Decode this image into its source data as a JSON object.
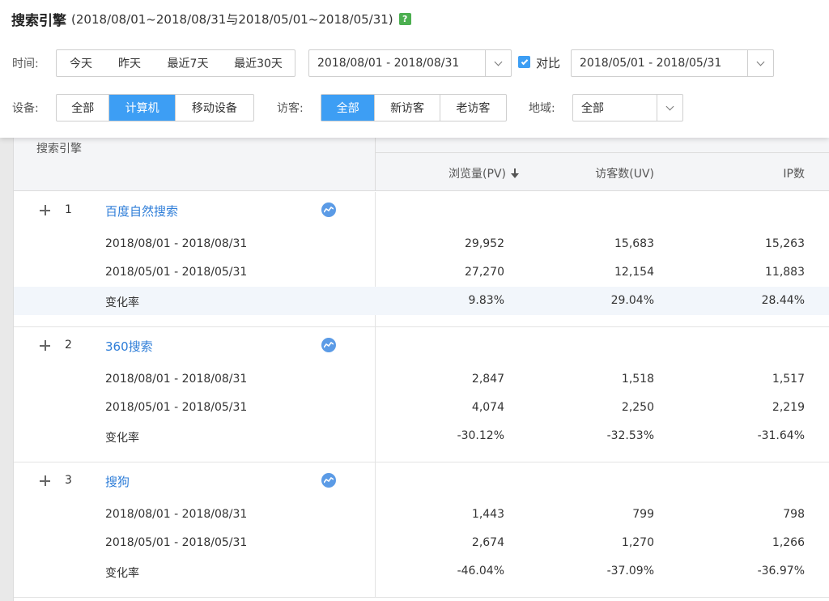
{
  "header": {
    "title": "搜索引擎",
    "title_range": "(2018/08/01~2018/08/31与2018/05/01~2018/05/31)",
    "help_label": "?"
  },
  "filters": {
    "time_label": "时间:",
    "time_buttons": [
      "今天",
      "昨天",
      "最近7天",
      "最近30天"
    ],
    "date_range": "2018/08/01 - 2018/08/31",
    "compare_label": "对比",
    "compare_checked": true,
    "compare_range": "2018/05/01 - 2018/05/31",
    "device_label": "设备:",
    "device_buttons": [
      "全部",
      "计算机",
      "移动设备"
    ],
    "device_active": "计算机",
    "visitor_label": "访客:",
    "visitor_buttons": [
      "全部",
      "新访客",
      "老访客"
    ],
    "visitor_active": "全部",
    "region_label": "地域:",
    "region_value": "全部"
  },
  "table": {
    "name_header": "搜索引擎",
    "columns": [
      "浏览量(PV)",
      "访客数(UV)",
      "IP数"
    ],
    "sorted_column": "浏览量(PV)",
    "sort_direction": "desc",
    "groups": [
      {
        "rank": "1",
        "name": "百度自然搜索",
        "rows": [
          {
            "label": "2018/08/01 - 2018/08/31",
            "pv": "29,952",
            "uv": "15,683",
            "ip": "15,263"
          },
          {
            "label": "2018/05/01 - 2018/05/31",
            "pv": "27,270",
            "uv": "12,154",
            "ip": "11,883"
          },
          {
            "label": "变化率",
            "pv": "9.83%",
            "uv": "29.04%",
            "ip": "28.44%"
          }
        ]
      },
      {
        "rank": "2",
        "name": "360搜索",
        "rows": [
          {
            "label": "2018/08/01 - 2018/08/31",
            "pv": "2,847",
            "uv": "1,518",
            "ip": "1,517"
          },
          {
            "label": "2018/05/01 - 2018/05/31",
            "pv": "4,074",
            "uv": "2,250",
            "ip": "2,219"
          },
          {
            "label": "变化率",
            "pv": "-30.12%",
            "uv": "-32.53%",
            "ip": "-31.64%"
          }
        ]
      },
      {
        "rank": "3",
        "name": "搜狗",
        "rows": [
          {
            "label": "2018/08/01 - 2018/08/31",
            "pv": "1,443",
            "uv": "799",
            "ip": "798"
          },
          {
            "label": "2018/05/01 - 2018/05/31",
            "pv": "2,674",
            "uv": "1,270",
            "ip": "1,266"
          },
          {
            "label": "变化率",
            "pv": "-46.04%",
            "uv": "-37.09%",
            "ip": "-36.97%"
          }
        ]
      }
    ]
  },
  "colors": {
    "accent": "#3d9ef4",
    "link": "#2f7ed8",
    "help_badge": "#4caf50",
    "change_row_bg": "#f2f6fb"
  },
  "icons": {
    "help": "help-icon",
    "dropdown": "chevron-down-icon",
    "sort": "sort-desc-icon",
    "expand": "plus-icon",
    "trend": "trend-chart-icon"
  }
}
